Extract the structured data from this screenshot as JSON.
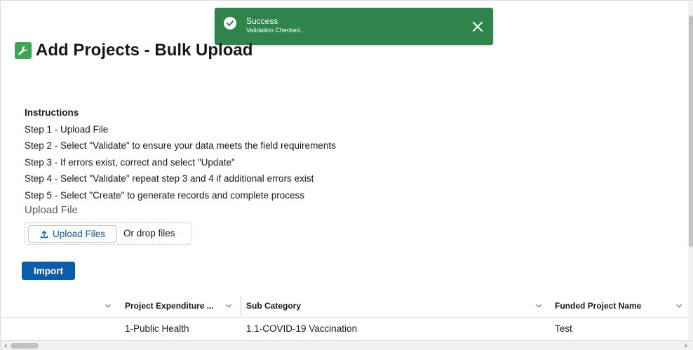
{
  "toast": {
    "title": "Success",
    "message": "Validation Checked...",
    "icon": "success-check-icon",
    "close_icon": "close-icon",
    "color": "#2e844a"
  },
  "header": {
    "title": "Add Projects - Bulk Upload",
    "icon": "wrench-icon",
    "icon_color": "#3ba755"
  },
  "instructions": {
    "title": "Instructions",
    "steps": [
      "Step 1 - Upload File",
      "Step 2 - Select \"Validate\" to ensure your data meets the field requirements",
      "Step 3 - If errors exist, correct and select \"Update\"",
      "Step 4 - Select \"Validate\" repeat step 3 and 4 if additional errors exist",
      "Step 5 - Select \"Create\" to generate records and complete process"
    ]
  },
  "upload": {
    "label": "Upload File",
    "button_label": "Upload Files",
    "drop_text": "Or drop files"
  },
  "import_button": {
    "label": "Import",
    "color": "#0b5cab"
  },
  "table": {
    "columns": [
      "Project Expenditure ...",
      "Sub Category",
      "Funded Project Name"
    ],
    "rows": [
      [
        "1-Public Health",
        "1.1-COVID-19 Vaccination",
        "Test"
      ]
    ]
  }
}
